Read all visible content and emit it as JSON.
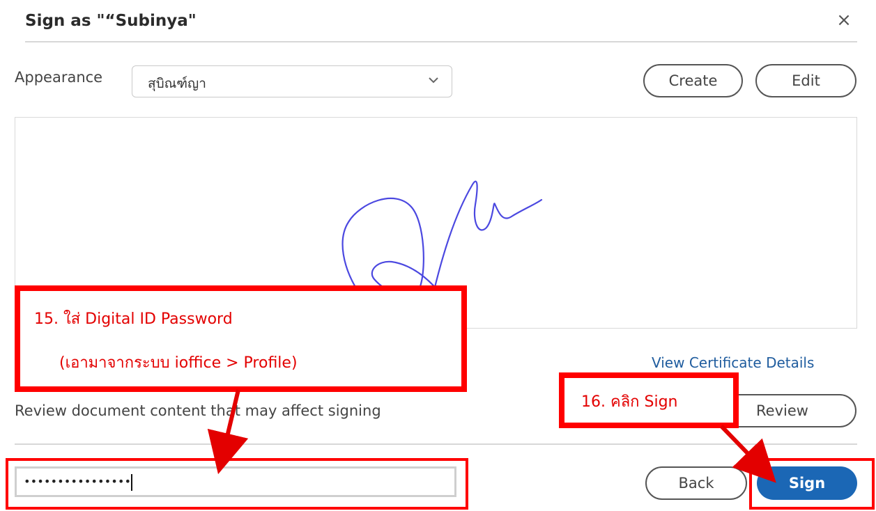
{
  "dialog": {
    "title": "Sign as \"“Subinya\"",
    "close_icon": "×"
  },
  "appearance": {
    "label": "Appearance",
    "selected": "สุบิณฑ์ญา",
    "create_label": "Create",
    "edit_label": "Edit"
  },
  "certificate": {
    "view_details_label": "View Certificate Details"
  },
  "review": {
    "text": "Review document content that may affect signing",
    "button_label": "Review"
  },
  "password": {
    "value": "••••••••••••••••"
  },
  "actions": {
    "back_label": "Back",
    "sign_label": "Sign"
  },
  "annotations": {
    "step15_line1": "15. ใส่ Digital ID Password",
    "step15_line2": "(เอามาจากระบบ ioffice > Profile)",
    "step16": "16. คลิก Sign"
  },
  "colors": {
    "accent": "#1b67b5",
    "annotation_red": "#ff0000",
    "signature_ink": "#4b48e0"
  }
}
